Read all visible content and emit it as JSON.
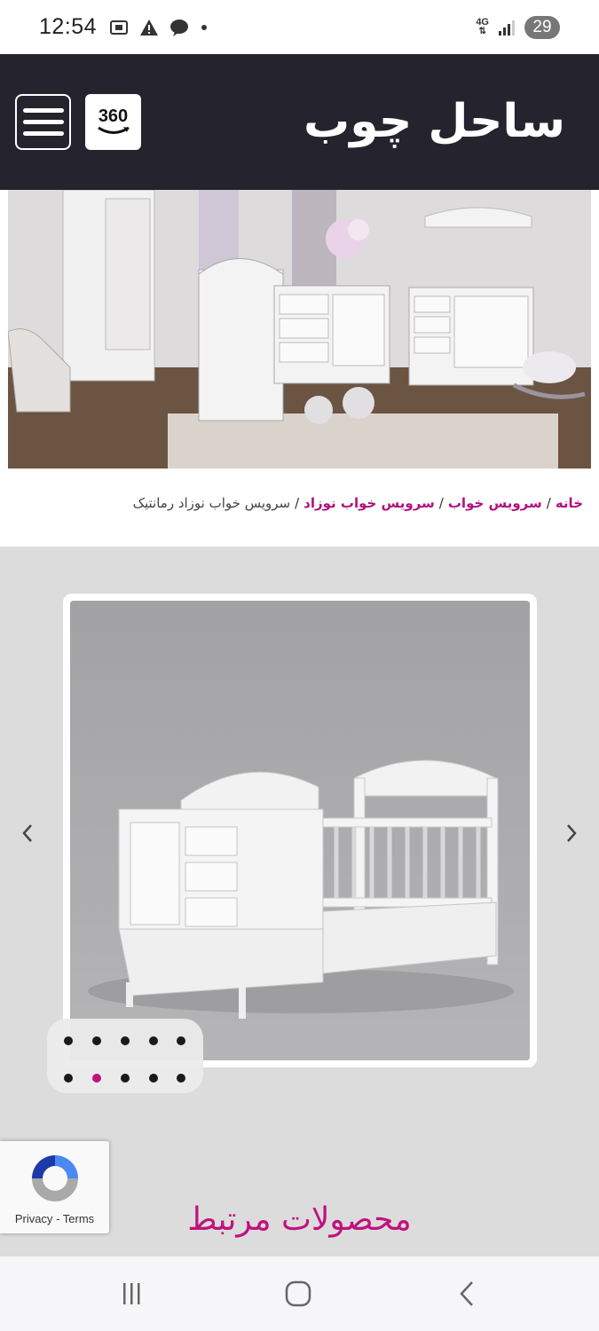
{
  "status_bar": {
    "time": "12:54",
    "network": "4G",
    "battery": "29",
    "icons": [
      "screenshot-icon",
      "alert-icon",
      "chat-bubble-icon",
      "dot-icon",
      "signal-icon"
    ]
  },
  "header": {
    "logo_text": "ساحل چوب",
    "tour_label": "360",
    "icons": [
      "menu-icon",
      "tour-360-icon"
    ]
  },
  "breadcrumb": {
    "items": [
      {
        "label": "خانه",
        "link": true
      },
      {
        "label": "سرویس خواب",
        "link": true
      },
      {
        "label": "سرویس خواب نوزاد",
        "link": true
      },
      {
        "label": "سرویس خواب نوزاد رمانتیک",
        "link": false
      }
    ],
    "separator": "/"
  },
  "gallery": {
    "slide_count": 10,
    "active_index": 6,
    "icons": [
      "chevron-left-icon",
      "chevron-right-icon"
    ]
  },
  "related": {
    "title": "محصولات مرتبط"
  },
  "recaptcha": {
    "privacy": "Privacy",
    "separator": "-",
    "terms": "Terms"
  },
  "colors": {
    "header_bg": "#24232e",
    "accent": "#c0127e",
    "section_bg": "#dcdcdc"
  }
}
